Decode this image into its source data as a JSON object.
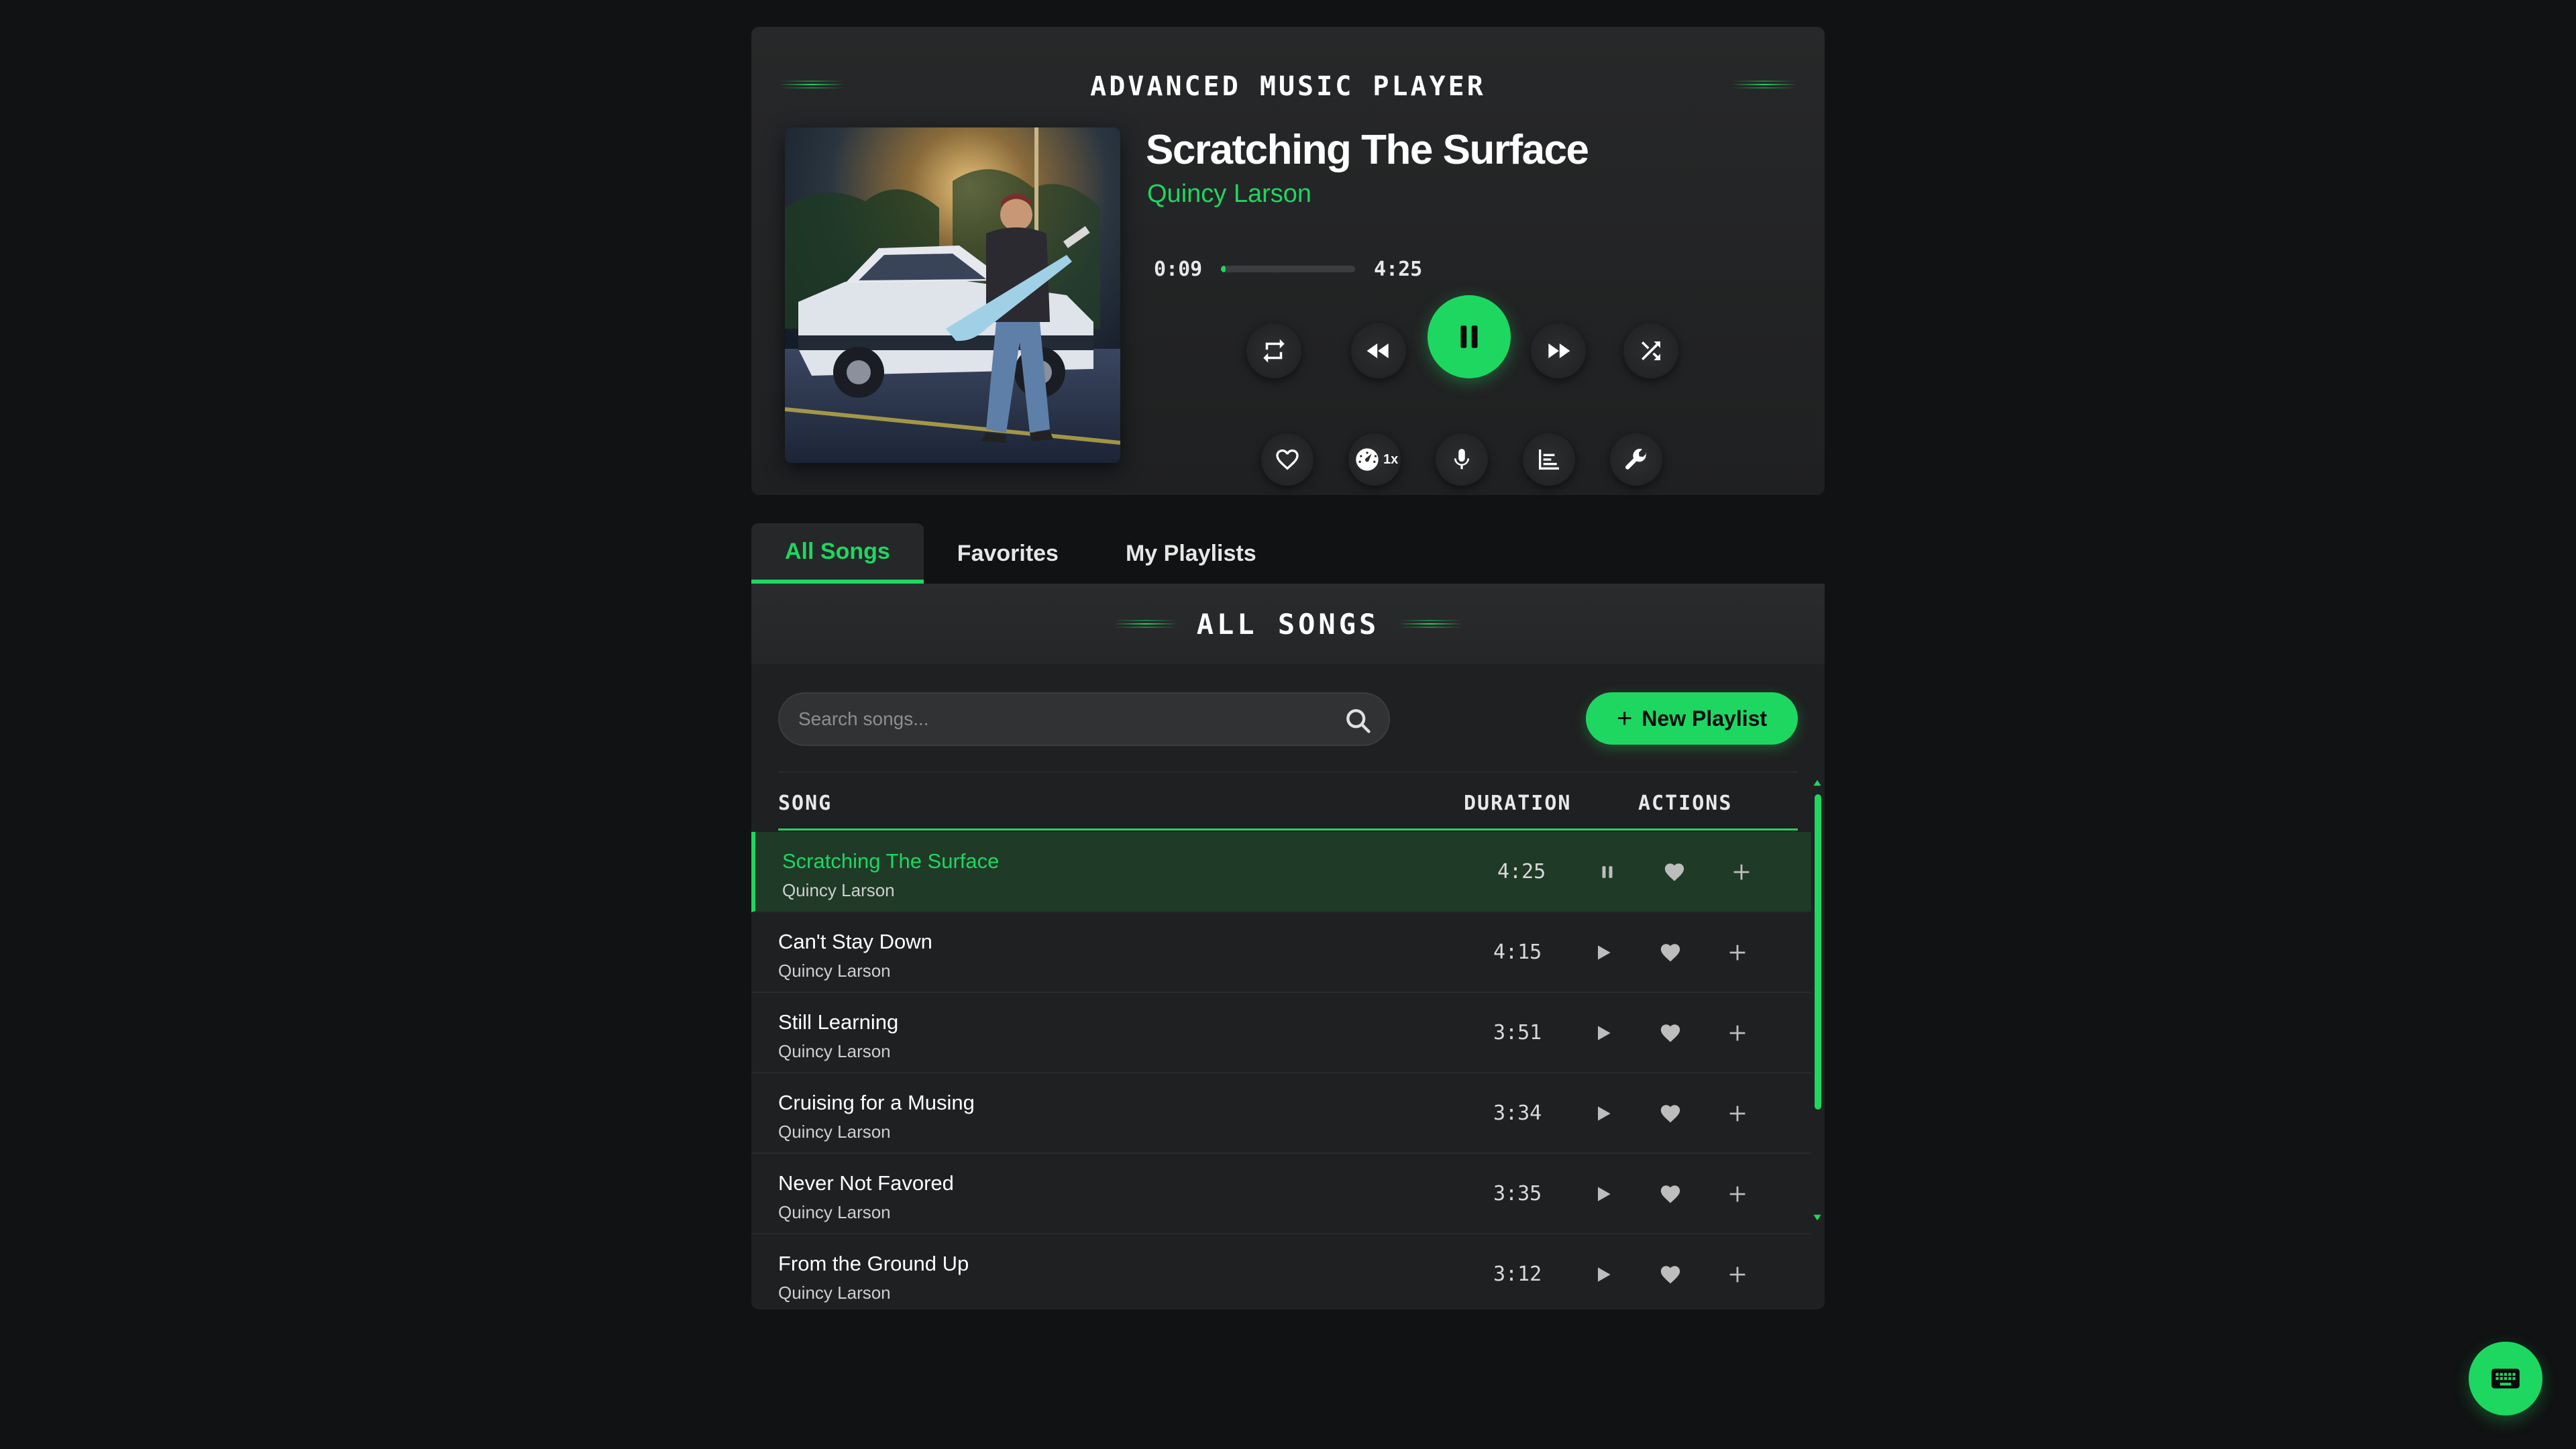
{
  "player": {
    "header_title": "ADVANCED MUSIC PLAYER",
    "song_title": "Scratching The Surface",
    "artist": "Quincy Larson",
    "current_time": "0:09",
    "total_time": "4:25",
    "progress_fraction": 0.035,
    "speed_label": "1x",
    "icons": [
      "repeat-icon",
      "previous-icon",
      "pause-icon",
      "next-icon",
      "shuffle-icon",
      "heart-icon",
      "speedometer-icon",
      "microphone-icon",
      "equalizer-icon",
      "wrench-icon"
    ]
  },
  "tabs": [
    {
      "label": "All Songs",
      "active": true
    },
    {
      "label": "Favorites",
      "active": false
    },
    {
      "label": "My Playlists",
      "active": false
    }
  ],
  "panel": {
    "title": "ALL SONGS",
    "search_placeholder": "Search songs...",
    "new_playlist_label": "New Playlist",
    "columns": {
      "song": "SONG",
      "duration": "DURATION",
      "actions": "ACTIONS"
    }
  },
  "songs": [
    {
      "title": "Scratching The Surface",
      "artist": "Quincy Larson",
      "duration": "4:25",
      "playing": true
    },
    {
      "title": "Can't Stay Down",
      "artist": "Quincy Larson",
      "duration": "4:15",
      "playing": false
    },
    {
      "title": "Still Learning",
      "artist": "Quincy Larson",
      "duration": "3:51",
      "playing": false
    },
    {
      "title": "Cruising for a Musing",
      "artist": "Quincy Larson",
      "duration": "3:34",
      "playing": false
    },
    {
      "title": "Never Not Favored",
      "artist": "Quincy Larson",
      "duration": "3:35",
      "playing": false
    },
    {
      "title": "From the Ground Up",
      "artist": "Quincy Larson",
      "duration": "3:12",
      "playing": false
    }
  ],
  "colors": {
    "accent": "#1ed760",
    "background": "#111213",
    "card": "#1f2021"
  }
}
